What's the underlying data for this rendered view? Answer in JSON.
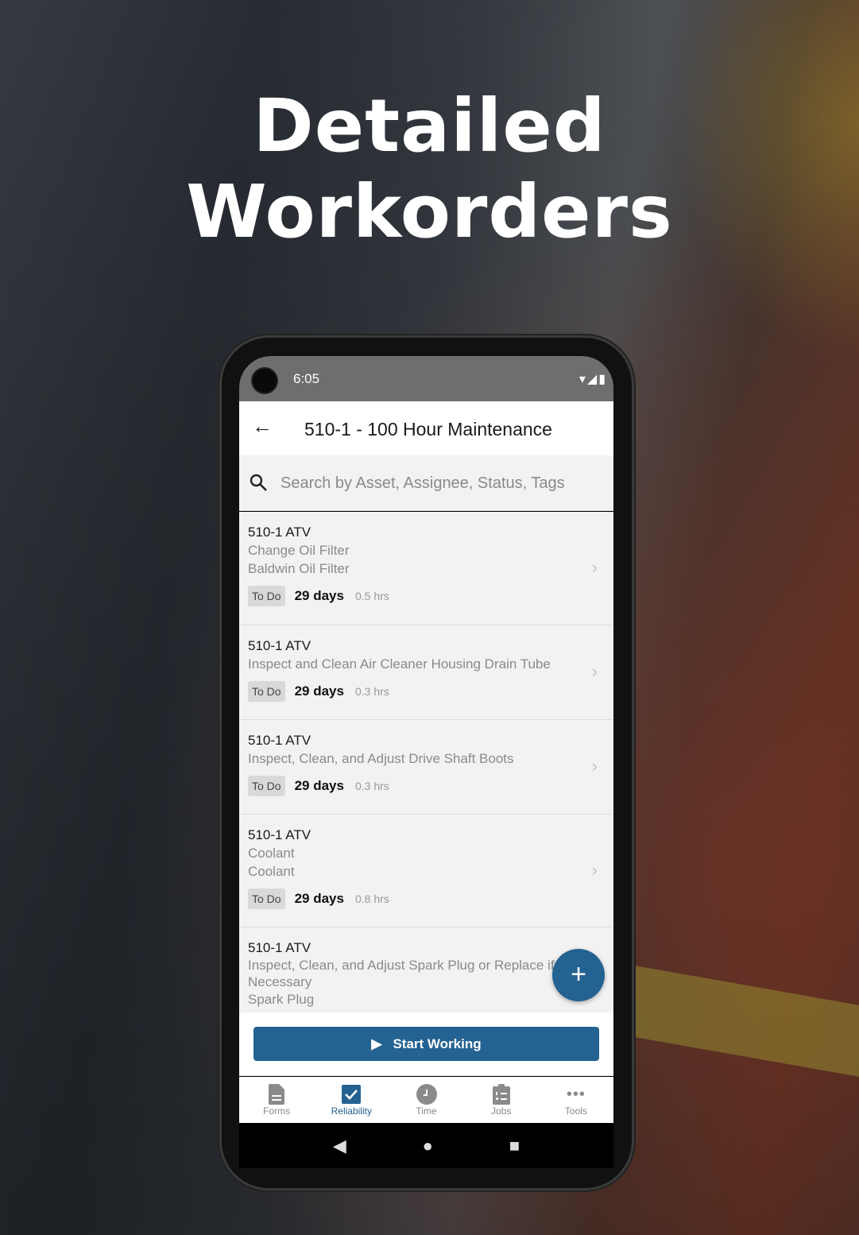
{
  "headline": {
    "line1": "Detailed",
    "line2": "Workorders"
  },
  "status_bar": {
    "time": "6:05",
    "icons": "▾◢▮"
  },
  "app_bar": {
    "title": "510-1 - 100 Hour Maintenance"
  },
  "search": {
    "placeholder": "Search by Asset, Assignee, Status, Tags"
  },
  "workorders": [
    {
      "asset": "510-1 ATV",
      "lines": [
        "Change Oil Filter",
        "Baldwin Oil Filter"
      ],
      "status": "To Do",
      "due": "29 days",
      "hours": "0.5 hrs"
    },
    {
      "asset": "510-1 ATV",
      "lines": [
        "Inspect and Clean Air Cleaner Housing Drain Tube"
      ],
      "status": "To Do",
      "due": "29 days",
      "hours": "0.3 hrs"
    },
    {
      "asset": "510-1 ATV",
      "lines": [
        "Inspect, Clean, and Adjust Drive Shaft Boots"
      ],
      "status": "To Do",
      "due": "29 days",
      "hours": "0.3 hrs"
    },
    {
      "asset": "510-1 ATV",
      "lines": [
        "Coolant",
        "Coolant"
      ],
      "status": "To Do",
      "due": "29 days",
      "hours": "0.8 hrs"
    },
    {
      "asset": "510-1 ATV",
      "lines": [
        "Inspect, Clean, and Adjust Spark Plug or Replace if Necessary",
        "Spark Plug"
      ]
    }
  ],
  "fab": {
    "label": "+"
  },
  "start_button": {
    "label": "Start Working"
  },
  "tabs": [
    {
      "label": "Forms"
    },
    {
      "label": "Reliability",
      "active": true
    },
    {
      "label": "Time"
    },
    {
      "label": "Jobs"
    },
    {
      "label": "Tools"
    }
  ],
  "nav": {
    "back": "◀",
    "home": "●",
    "recents": "■"
  },
  "colors": {
    "accent": "#246291",
    "list_bg": "#f2f2f2",
    "status_bar": "#6e6e6e"
  }
}
